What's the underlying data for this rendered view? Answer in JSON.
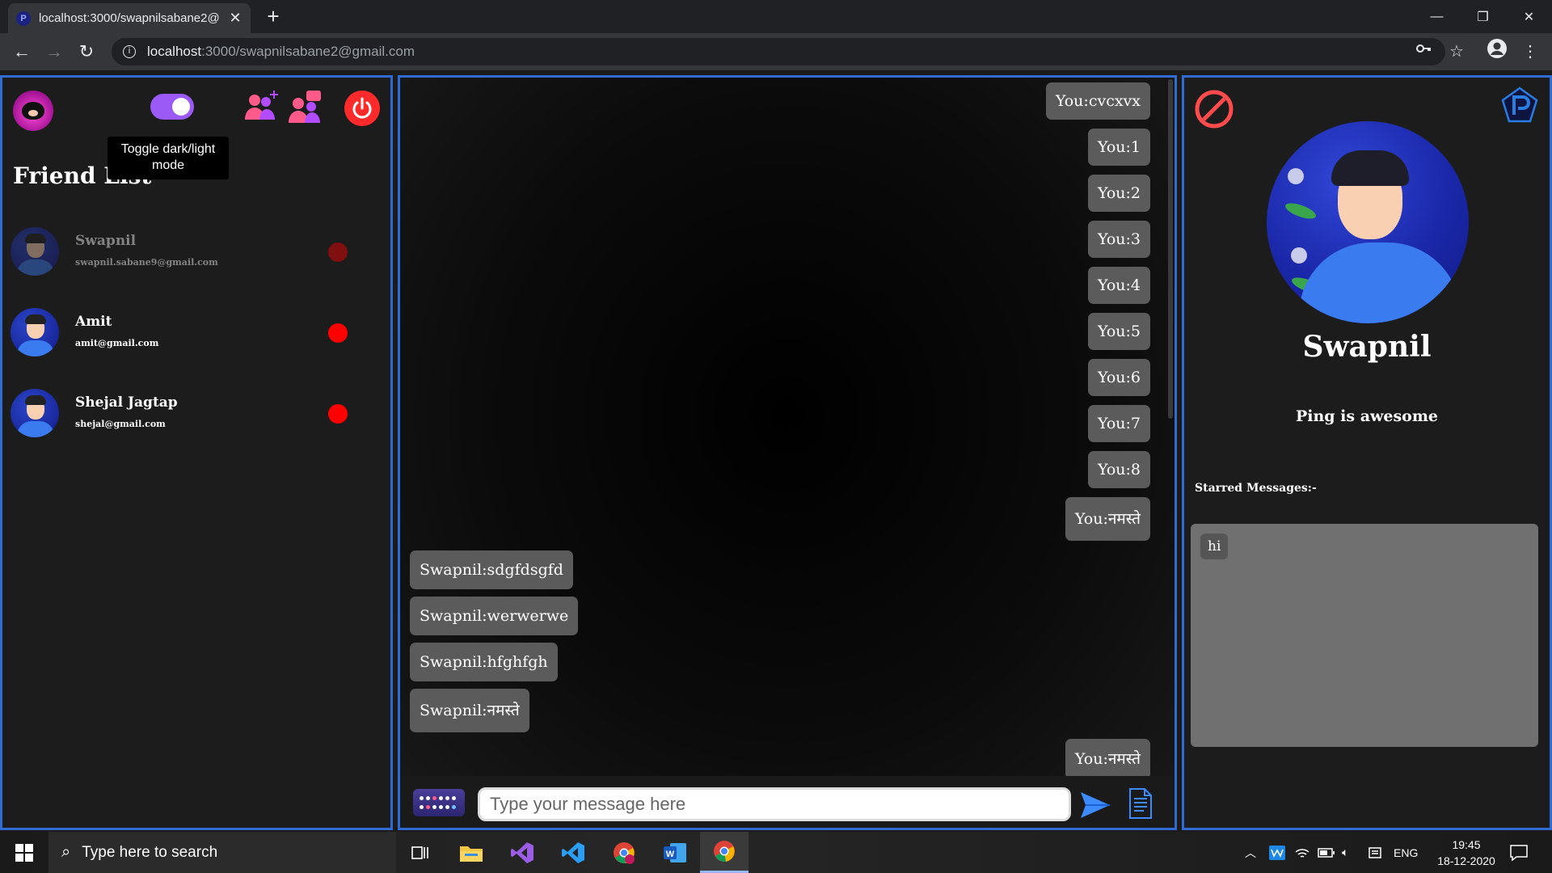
{
  "browser": {
    "tab_title": "localhost:3000/swapnilsabane2@",
    "tab_favicon": "P",
    "close_glyph": "✕",
    "new_tab_glyph": "+",
    "url_host": "localhost",
    "url_path": ":3000/swapnilsabane2@gmail.com",
    "back_glyph": "←",
    "forward_glyph": "→",
    "reload_glyph": "↻",
    "minimize_glyph": "—",
    "restore_glyph": "❐",
    "window_close_glyph": "✕"
  },
  "sidebar": {
    "tooltip": "Toggle dark/light mode",
    "title": "Friend List",
    "friends": [
      {
        "name": "Swapnil",
        "email": "swapnil.sabane9@gmail.com",
        "status_color": "#ff0000"
      },
      {
        "name": "Amit",
        "email": "amit@gmail.com",
        "status_color": "#ff0000"
      },
      {
        "name": "Shejal Jagtap",
        "email": "shejal@gmail.com",
        "status_color": "#ff0000"
      }
    ]
  },
  "chat": {
    "messages": [
      {
        "text": "You:cvcxvx",
        "from": "me"
      },
      {
        "text": "You:1",
        "from": "me"
      },
      {
        "text": "You:2",
        "from": "me"
      },
      {
        "text": "You:3",
        "from": "me"
      },
      {
        "text": "You:4",
        "from": "me"
      },
      {
        "text": "You:5",
        "from": "me"
      },
      {
        "text": "You:6",
        "from": "me"
      },
      {
        "text": "You:7",
        "from": "me"
      },
      {
        "text": "You:8",
        "from": "me"
      },
      {
        "text": "You:नमस्ते",
        "from": "me"
      },
      {
        "text": "Swapnil:sdgfdsgfd",
        "from": "them"
      },
      {
        "text": "Swapnil:werwerwe",
        "from": "them"
      },
      {
        "text": "Swapnil:hfghfgh",
        "from": "them"
      },
      {
        "text": "Swapnil:नमस्ते",
        "from": "them"
      },
      {
        "text": "You:नमस्ते",
        "from": "me"
      }
    ],
    "input_placeholder": "Type your message here",
    "input_value": ""
  },
  "profile": {
    "name": "Swapnil",
    "status": "Ping is awesome",
    "starred_title": "Starred Messages:-",
    "starred": [
      "hi"
    ]
  },
  "taskbar": {
    "search_placeholder": "Type here to search",
    "language": "ENG",
    "time": "19:45",
    "date": "18-12-2020",
    "apps": [
      "task-view",
      "file-explorer",
      "visual-studio",
      "vs-code",
      "chrome-profile",
      "word",
      "chrome"
    ]
  },
  "colors": {
    "accent_border": "#2f6bd1",
    "toggle": "#9b59f5",
    "power": "#ff2a2a",
    "status_offline": "#ff0000",
    "bubble": "#5b5b5b"
  }
}
